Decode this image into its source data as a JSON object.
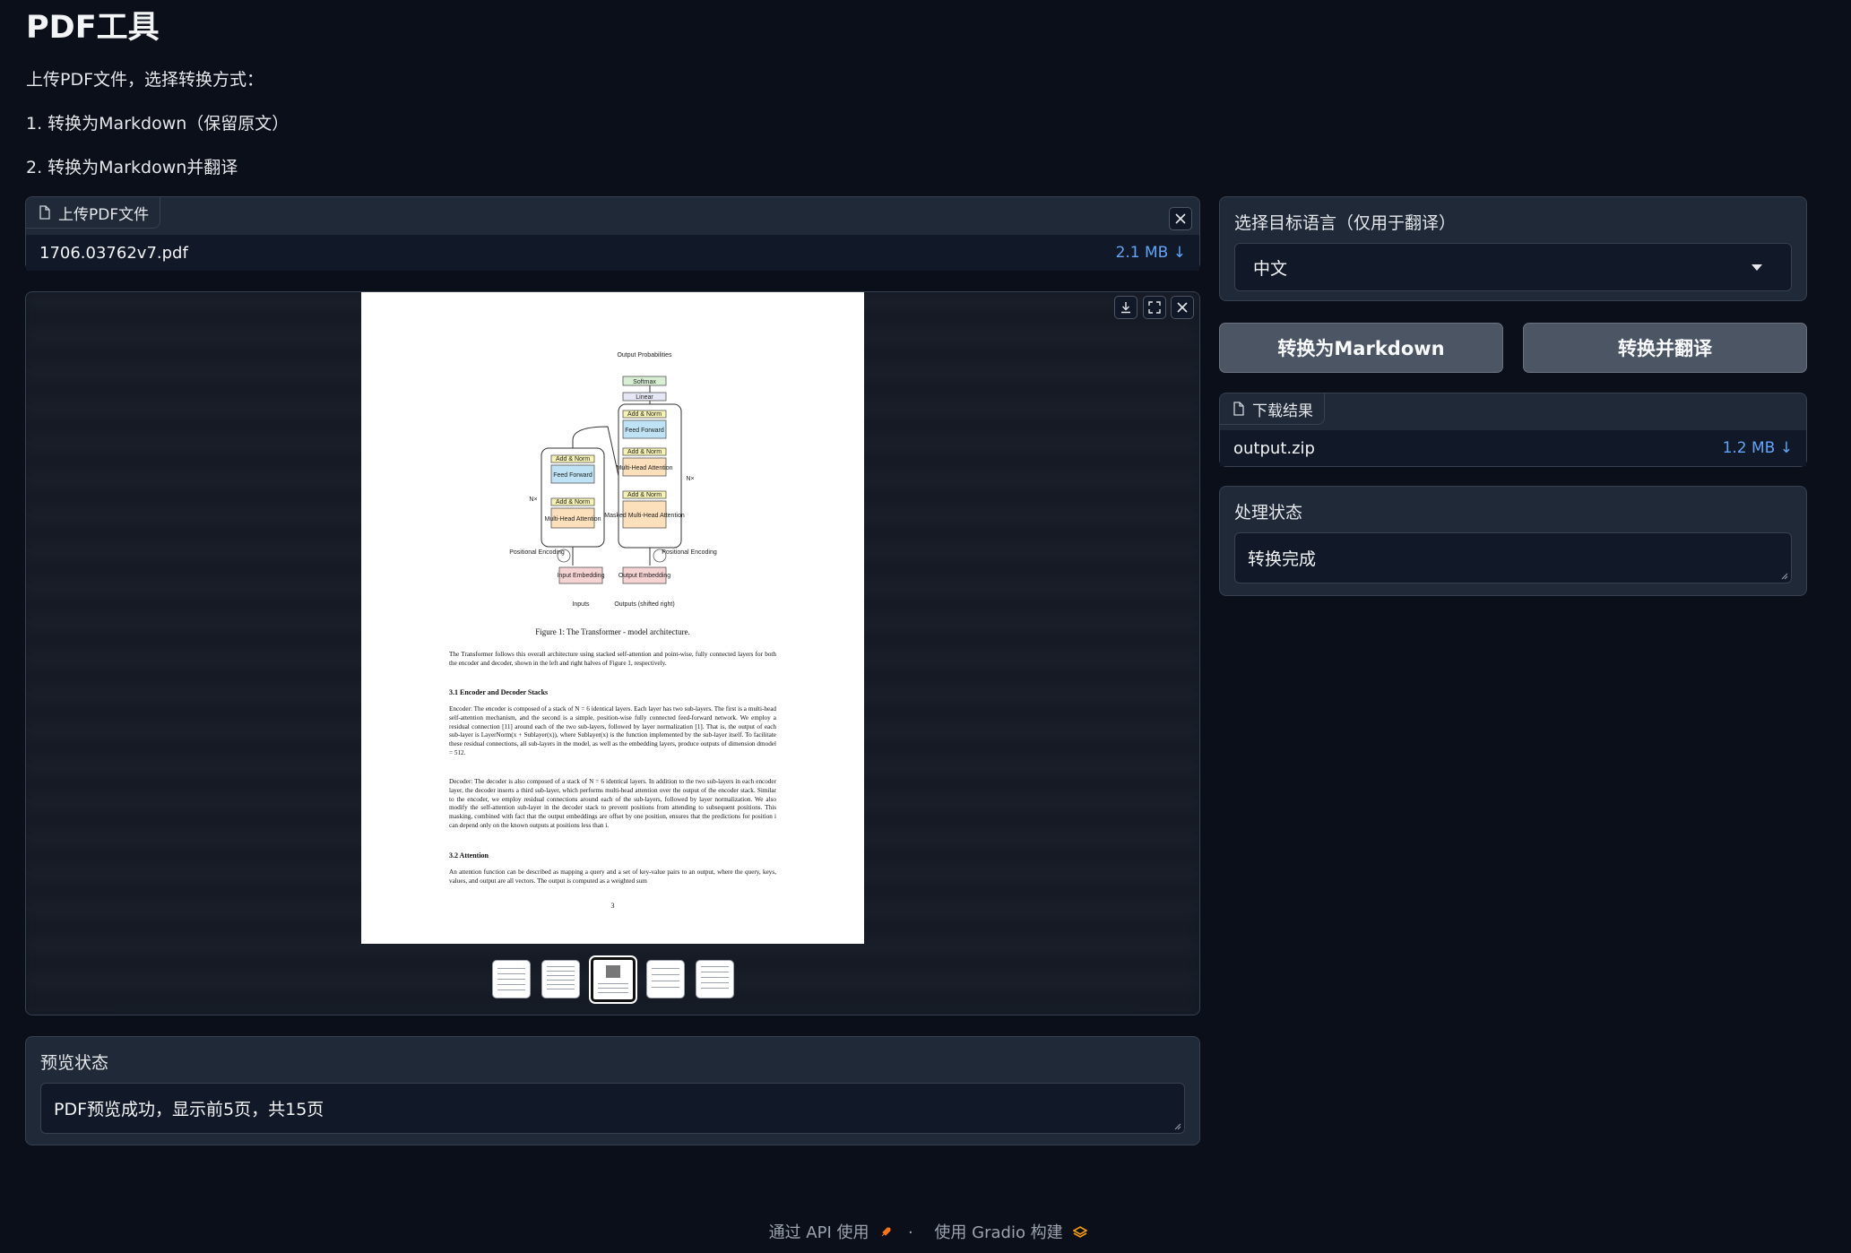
{
  "header": {
    "title": "PDF工具",
    "intro": "上传PDF文件，选择转换方式：",
    "option1": "1. 转换为Markdown（保留原文）",
    "option2": "2. 转换为Markdown并翻译"
  },
  "upload": {
    "label": "上传PDF文件",
    "file_name": "1706.03762v7.pdf",
    "file_size": "2.1 MB ↓"
  },
  "preview_page": {
    "figure_caption": "Figure 1: The Transformer - model architecture.",
    "para1": "The Transformer follows this overall architecture using stacked self-attention and point-wise, fully connected layers for both the encoder and decoder, shown in the left and right halves of Figure 1, respectively.",
    "heading1": "3.1   Encoder and Decoder Stacks",
    "para2": "Encoder: The encoder is composed of a stack of N = 6 identical layers. Each layer has two sub-layers. The first is a multi-head self-attention mechanism, and the second is a simple, position-wise fully connected feed-forward network. We employ a residual connection [11] around each of the two sub-layers, followed by layer normalization [1]. That is, the output of each sub-layer is LayerNorm(x + Sublayer(x)), where Sublayer(x) is the function implemented by the sub-layer itself. To facilitate these residual connections, all sub-layers in the model, as well as the embedding layers, produce outputs of dimension dmodel = 512.",
    "para3": "Decoder: The decoder is also composed of a stack of N = 6 identical layers. In addition to the two sub-layers in each encoder layer, the decoder inserts a third sub-layer, which performs multi-head attention over the output of the encoder stack. Similar to the encoder, we employ residual connections around each of the sub-layers, followed by layer normalization. We also modify the self-attention sub-layer in the decoder stack to prevent positions from attending to subsequent positions. This masking, combined with fact that the output embeddings are offset by one position, ensures that the predictions for position i can depend only on the known outputs at positions less than i.",
    "heading2": "3.2   Attention",
    "para4": "An attention function can be described as mapping a query and a set of key-value pairs to an output, where the query, keys, values, and output are all vectors. The output is computed as a weighted sum",
    "page_number": "3",
    "diagram": {
      "output_probs": "Output Probabilities",
      "softmax": "Softmax",
      "linear": "Linear",
      "add_norm": "Add & Norm",
      "feed_forward": "Feed Forward",
      "multi_head": "Multi-Head Attention",
      "masked_multi_head": "Masked Multi-Head Attention",
      "nx": "N×",
      "pos_enc": "Positional Encoding",
      "input_emb": "Input Embedding",
      "output_emb": "Output Embedding",
      "inputs": "Inputs",
      "outputs": "Outputs (shifted right)"
    }
  },
  "preview_status": {
    "label": "预览状态",
    "value": "PDF预览成功，显示前5页，共15页"
  },
  "language": {
    "label": "选择目标语言（仅用于翻译）",
    "selected": "中文"
  },
  "buttons": {
    "convert": "转换为Markdown",
    "translate": "转换并翻译"
  },
  "download": {
    "label": "下载结果",
    "file_name": "output.zip",
    "file_size": "1.2 MB ↓"
  },
  "process_status": {
    "label": "处理状态",
    "value": "转换完成"
  },
  "footer": {
    "api": "通过 API 使用",
    "sep": "·",
    "built": "使用 Gradio 构建"
  }
}
